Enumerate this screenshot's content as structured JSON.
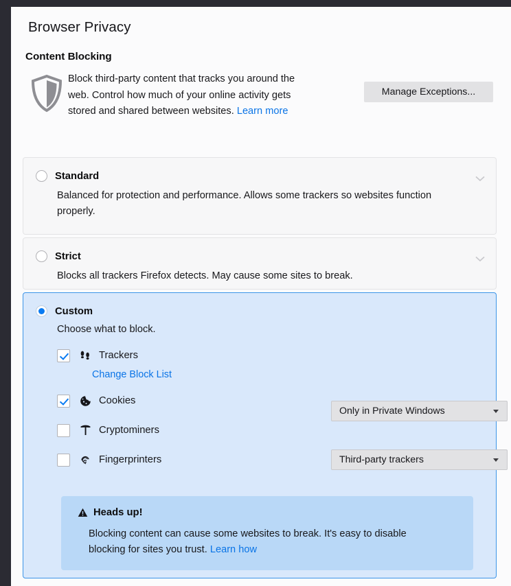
{
  "page": {
    "title": "Browser Privacy",
    "section_title": "Content Blocking",
    "description": "Block third-party content that tracks you around the web. Control how much of your online activity gets stored and shared between websites.",
    "description_link": "Learn more",
    "manage_exceptions_button": "Manage Exceptions..."
  },
  "options": {
    "standard": {
      "label": "Standard",
      "description": "Balanced for protection and performance. Allows some trackers so websites function properly.",
      "selected": false
    },
    "strict": {
      "label": "Strict",
      "description": "Blocks all trackers Firefox detects. May cause some sites to break.",
      "selected": false
    },
    "custom": {
      "label": "Custom",
      "description": "Choose what to block.",
      "selected": true
    }
  },
  "custom_items": {
    "trackers": {
      "label": "Trackers",
      "checked": true,
      "icon": "footprints-icon",
      "sub_link": "Change Block List",
      "dropdown_value": "Only in Private Windows"
    },
    "cookies": {
      "label": "Cookies",
      "checked": true,
      "icon": "cookie-icon",
      "dropdown_value": "Third-party trackers"
    },
    "cryptominers": {
      "label": "Cryptominers",
      "checked": false,
      "icon": "pickaxe-icon"
    },
    "fingerprinters": {
      "label": "Fingerprinters",
      "checked": false,
      "icon": "fingerprint-icon"
    }
  },
  "heads_up": {
    "title": "Heads up!",
    "body": "Blocking content can cause some websites to break. It's easy to disable blocking for sites you trust.",
    "link": "Learn how"
  },
  "colors": {
    "accent_blue": "#0a7bf2",
    "link_blue": "#0a74e6",
    "custom_card_bg": "#d9e8fb",
    "custom_card_border": "#3b94e8",
    "headsup_bg": "#b9d8f7",
    "card_bg": "#f7f7f8",
    "button_bg": "#e2e2e4"
  }
}
